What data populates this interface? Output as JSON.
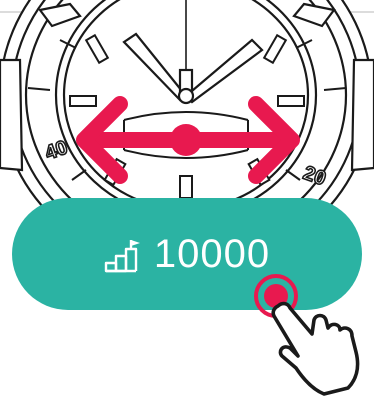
{
  "bezel": {
    "left_mark": "40",
    "right_mark": "20"
  },
  "goal": {
    "value": "10000",
    "icon": "steps-goal-icon"
  },
  "colors": {
    "accent": "#2bb3a3",
    "arrow": "#e8194f"
  },
  "gesture": {
    "hint": "swipe-left-right",
    "tap_icon": "hand-pointer-icon"
  }
}
